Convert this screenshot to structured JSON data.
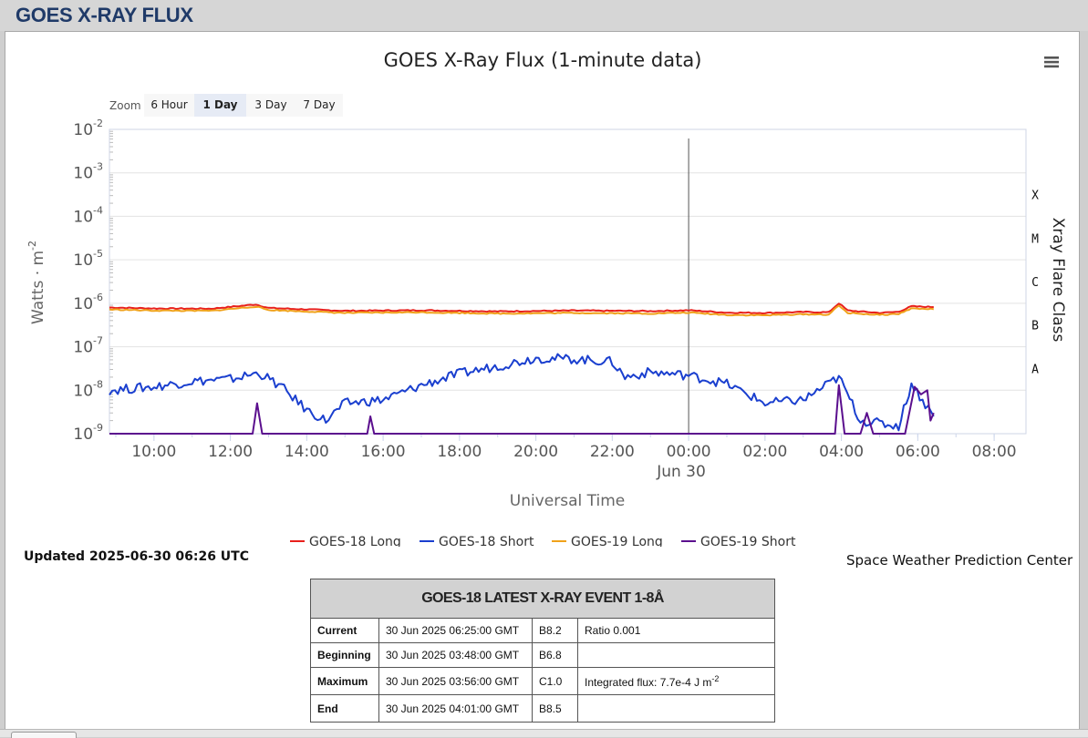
{
  "page": {
    "title": "GOES X-RAY FLUX"
  },
  "zoom": {
    "label": "Zoom",
    "options": [
      "6 Hour",
      "1 Day",
      "3 Day",
      "7 Day"
    ],
    "selected": "1 Day"
  },
  "chart_data": {
    "type": "line",
    "title": "GOES X-Ray Flux (1-minute data)",
    "xlabel": "Universal Time",
    "ylabel": "Watts · m",
    "ylabel_exponent": "-2",
    "y_scale": "log",
    "ylim": [
      1e-09,
      0.01
    ],
    "y_ticks": [
      {
        "base": "10",
        "exp": "-2"
      },
      {
        "base": "10",
        "exp": "-3"
      },
      {
        "base": "10",
        "exp": "-4"
      },
      {
        "base": "10",
        "exp": "-5"
      },
      {
        "base": "10",
        "exp": "-6"
      },
      {
        "base": "10",
        "exp": "-7"
      },
      {
        "base": "10",
        "exp": "-8"
      },
      {
        "base": "10",
        "exp": "-9"
      }
    ],
    "x_range": [
      "2025-06-29 08:50",
      "2025-06-30 08:50"
    ],
    "x_ticks": [
      "10:00",
      "12:00",
      "14:00",
      "16:00",
      "18:00",
      "20:00",
      "22:00",
      "00:00",
      "02:00",
      "04:00",
      "06:00",
      "08:00"
    ],
    "x_date_label": "Jun 30",
    "right_axis_title": "Xray Flare Class",
    "flare_classes": [
      "X",
      "M",
      "C",
      "B",
      "A"
    ],
    "grid": true,
    "legend_position": "bottom",
    "series": [
      {
        "name": "GOES-18 Long",
        "color": "#e8201c",
        "points": [
          [
            "2025-06-29 08:50",
            8e-07
          ],
          [
            "2025-06-29 10:00",
            7.6e-07
          ],
          [
            "2025-06-29 11:30",
            7.5e-07
          ],
          [
            "2025-06-29 12:40",
            9.4e-07
          ],
          [
            "2025-06-29 13:00",
            7.8e-07
          ],
          [
            "2025-06-29 15:00",
            6.7e-07
          ],
          [
            "2025-06-29 17:00",
            6.9e-07
          ],
          [
            "2025-06-29 19:00",
            6.5e-07
          ],
          [
            "2025-06-29 21:00",
            6.8e-07
          ],
          [
            "2025-06-29 23:00",
            6.6e-07
          ],
          [
            "2025-06-30 00:00",
            6.9e-07
          ],
          [
            "2025-06-30 01:00",
            6.1e-07
          ],
          [
            "2025-06-30 02:00",
            6e-07
          ],
          [
            "2025-06-30 03:00",
            6.3e-07
          ],
          [
            "2025-06-30 03:40",
            6.2e-07
          ],
          [
            "2025-06-30 03:56",
            1e-06
          ],
          [
            "2025-06-30 04:10",
            6.8e-07
          ],
          [
            "2025-06-30 05:00",
            6e-07
          ],
          [
            "2025-06-30 05:30",
            6.4e-07
          ],
          [
            "2025-06-30 05:50",
            8.5e-07
          ],
          [
            "2025-06-30 06:25",
            8.2e-07
          ]
        ]
      },
      {
        "name": "GOES-18 Short",
        "color": "#1a3fcf",
        "points": [
          [
            "2025-06-29 08:50",
            1e-08
          ],
          [
            "2025-06-29 10:00",
            1.2e-08
          ],
          [
            "2025-06-29 11:00",
            1.6e-08
          ],
          [
            "2025-06-29 12:00",
            1.8e-08
          ],
          [
            "2025-06-29 12:45",
            2.5e-08
          ],
          [
            "2025-06-29 13:20",
            1.2e-08
          ],
          [
            "2025-06-29 14:00",
            3.5e-09
          ],
          [
            "2025-06-29 14:30",
            2e-09
          ],
          [
            "2025-06-29 15:00",
            5e-09
          ],
          [
            "2025-06-29 16:00",
            6e-09
          ],
          [
            "2025-06-29 17:00",
            1.3e-08
          ],
          [
            "2025-06-29 18:00",
            2.4e-08
          ],
          [
            "2025-06-29 19:00",
            3.6e-08
          ],
          [
            "2025-06-29 20:00",
            5.5e-08
          ],
          [
            "2025-06-29 21:00",
            5.2e-08
          ],
          [
            "2025-06-29 22:00",
            4.5e-08
          ],
          [
            "2025-06-29 22:20",
            2e-08
          ],
          [
            "2025-06-29 23:00",
            2.6e-08
          ],
          [
            "2025-06-30 00:00",
            2.2e-08
          ],
          [
            "2025-06-30 01:00",
            1.4e-08
          ],
          [
            "2025-06-30 02:00",
            5e-09
          ],
          [
            "2025-06-30 03:00",
            6e-09
          ],
          [
            "2025-06-30 03:56",
            2e-08
          ],
          [
            "2025-06-30 04:30",
            2e-09
          ],
          [
            "2025-06-30 05:30",
            1.5e-09
          ],
          [
            "2025-06-30 05:50",
            1.4e-08
          ],
          [
            "2025-06-30 06:25",
            2.5e-09
          ]
        ]
      },
      {
        "name": "GOES-19 Long",
        "color": "#f0a21a",
        "points": [
          [
            "2025-06-29 08:50",
            7.2e-07
          ],
          [
            "2025-06-29 10:00",
            6.8e-07
          ],
          [
            "2025-06-29 11:30",
            6.7e-07
          ],
          [
            "2025-06-29 12:40",
            8.4e-07
          ],
          [
            "2025-06-29 13:00",
            7e-07
          ],
          [
            "2025-06-29 15:00",
            6e-07
          ],
          [
            "2025-06-29 17:00",
            6.2e-07
          ],
          [
            "2025-06-29 19:00",
            5.8e-07
          ],
          [
            "2025-06-29 21:00",
            6e-07
          ],
          [
            "2025-06-29 23:00",
            5.8e-07
          ],
          [
            "2025-06-30 00:00",
            6.1e-07
          ],
          [
            "2025-06-30 01:00",
            5.4e-07
          ],
          [
            "2025-06-30 02:00",
            5.3e-07
          ],
          [
            "2025-06-30 03:00",
            5.6e-07
          ],
          [
            "2025-06-30 03:40",
            5.5e-07
          ],
          [
            "2025-06-30 03:56",
            8.8e-07
          ],
          [
            "2025-06-30 04:10",
            6e-07
          ],
          [
            "2025-06-30 05:00",
            5.4e-07
          ],
          [
            "2025-06-30 05:30",
            5.7e-07
          ],
          [
            "2025-06-30 05:50",
            7.6e-07
          ],
          [
            "2025-06-30 06:25",
            7.3e-07
          ]
        ]
      },
      {
        "name": "GOES-19 Short",
        "color": "#5b0f8e",
        "points": [
          [
            "2025-06-29 08:50",
            1e-09
          ],
          [
            "2025-06-29 12:35",
            1e-09
          ],
          [
            "2025-06-29 12:42",
            5e-09
          ],
          [
            "2025-06-29 12:50",
            1e-09
          ],
          [
            "2025-06-29 15:35",
            1e-09
          ],
          [
            "2025-06-29 15:40",
            2.5e-09
          ],
          [
            "2025-06-29 15:46",
            1e-09
          ],
          [
            "2025-06-30 03:50",
            1e-09
          ],
          [
            "2025-06-30 03:56",
            1.3e-08
          ],
          [
            "2025-06-30 04:05",
            1e-09
          ],
          [
            "2025-06-30 04:30",
            1e-09
          ],
          [
            "2025-06-30 04:40",
            3e-09
          ],
          [
            "2025-06-30 04:50",
            1e-09
          ],
          [
            "2025-06-30 05:40",
            1e-09
          ],
          [
            "2025-06-30 05:55",
            1.2e-08
          ],
          [
            "2025-06-30 06:05",
            8e-09
          ],
          [
            "2025-06-30 06:15",
            1e-08
          ],
          [
            "2025-06-30 06:20",
            2e-09
          ],
          [
            "2025-06-30 06:25",
            3e-09
          ]
        ]
      }
    ]
  },
  "footer": {
    "updated": "Updated 2025-06-30 06:26 UTC",
    "credit": "Space Weather Prediction Center"
  },
  "event_table": {
    "title": "GOES-18 LATEST X-RAY EVENT 1-8Å",
    "rows": [
      {
        "label": "Current",
        "time": "30 Jun 2025 06:25:00 GMT",
        "class": "B8.2",
        "note": "Ratio 0.001"
      },
      {
        "label": "Beginning",
        "time": "30 Jun 2025 03:48:00 GMT",
        "class": "B6.8",
        "note": ""
      },
      {
        "label": "Maximum",
        "time": "30 Jun 2025 03:56:00 GMT",
        "class": "C1.0",
        "note": "Integrated flux: 7.7e-4 J m",
        "note_exp": "-2"
      },
      {
        "label": "End",
        "time": "30 Jun 2025 04:01:00 GMT",
        "class": "B8.5",
        "note": ""
      }
    ]
  }
}
